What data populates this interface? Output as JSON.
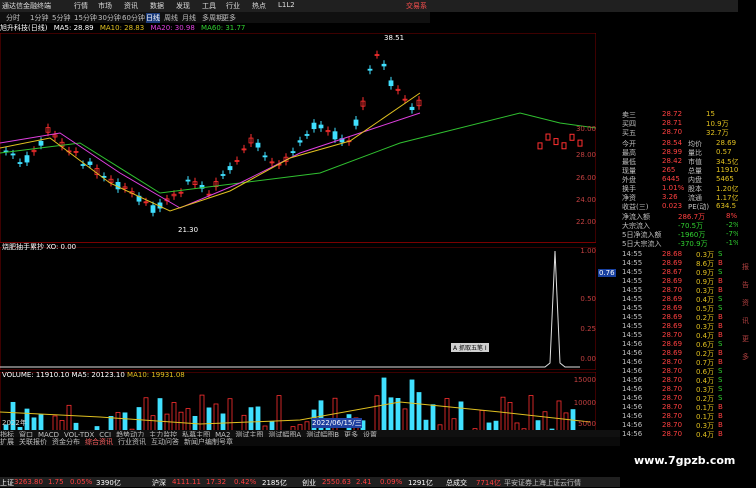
{
  "titlebar": {
    "app": "通达信金融终端",
    "menu": [
      "行情",
      "市场",
      "资讯",
      "数据",
      "发现",
      "工具",
      "行业",
      "热点",
      "L1L2"
    ],
    "right_label": "交易系"
  },
  "periods": [
    "分时",
    "1分钟",
    "5分钟",
    "15分钟",
    "30分钟",
    "60分钟",
    "日线",
    "周线",
    "月线",
    "多周期",
    "更多"
  ],
  "active_period": "日线",
  "stock": {
    "name": "旭升科技(日线)",
    "ma5": "MA5: 28.89",
    "ma10": "MA10: 28.83",
    "ma20": "MA20: 30.98",
    "ma60": "MA60: 31.77",
    "peak_label": "38.51",
    "low_label": "21.30"
  },
  "price_scale": [
    "30.00",
    "28.00",
    "26.00",
    "24.00",
    "22.00"
  ],
  "indicator": {
    "title": "烧肥抽手累抄 XO: 0.00",
    "scale": [
      "1.00",
      "0.76",
      "0.50",
      "0.25",
      "0.00"
    ],
    "tag": "0.76",
    "overlay_label": "A 抓取五笔 I"
  },
  "volume": {
    "title": "VOLUME: 11910.10",
    "ma5": "MA5: 20123.10",
    "ma10": "MA10: 19931.08",
    "scale": [
      "15000",
      "10000",
      "5000"
    ],
    "date_label": "2022/06/15/三",
    "year_label": "2022年"
  },
  "quote": {
    "ask": [
      {
        "label": "卖三",
        "price": "28.72",
        "vol": "15"
      },
      {
        "label": "买四",
        "price": "28.71",
        "vol": "10.9万"
      },
      {
        "label": "买五",
        "price": "28.70",
        "vol": "32.7万"
      }
    ],
    "stats": [
      {
        "l": "今开",
        "v": "28.54",
        "l2": "均价",
        "v2": "28.69"
      },
      {
        "l": "最高",
        "v": "28.99",
        "l2": "量比",
        "v2": "0.57"
      },
      {
        "l": "最低",
        "v": "28.42",
        "l2": "市值",
        "v2": "34.5亿"
      },
      {
        "l": "现量",
        "v": "265",
        "l2": "总量",
        "v2": "11910"
      },
      {
        "l": "外盘",
        "v": "6445",
        "l2": "内盘",
        "v2": "5465"
      },
      {
        "l": "换手",
        "v": "1.01%",
        "l2": "股本",
        "v2": "1.20亿"
      },
      {
        "l": "净资",
        "v": "3.26",
        "l2": "流通",
        "v2": "1.17亿"
      },
      {
        "l": "收益(三)",
        "v": "0.023",
        "l2": "PE(动)",
        "v2": "634.5"
      }
    ],
    "flows": [
      {
        "l": "净流入额",
        "v": "286.7万",
        "p": "8%"
      },
      {
        "l": "大宗流入",
        "v": "-70.5万",
        "p": "-2%"
      },
      {
        "l": "5日净流入额",
        "v": "-1960万",
        "p": "-7%"
      },
      {
        "l": "5日大宗流入",
        "v": "-370.9万",
        "p": "-1%"
      }
    ],
    "ticks": [
      {
        "t": "14:55",
        "p": "28.68",
        "v": "0.3万",
        "d": "S"
      },
      {
        "t": "14:55",
        "p": "28.69",
        "v": "8.6万",
        "d": "B"
      },
      {
        "t": "14:55",
        "p": "28.67",
        "v": "0.9万",
        "d": "S"
      },
      {
        "t": "14:55",
        "p": "28.69",
        "v": "0.9万",
        "d": "B"
      },
      {
        "t": "14:55",
        "p": "28.70",
        "v": "0.3万",
        "d": "B"
      },
      {
        "t": "14:55",
        "p": "28.69",
        "v": "0.4万",
        "d": "S"
      },
      {
        "t": "14:55",
        "p": "28.69",
        "v": "0.5万",
        "d": "S"
      },
      {
        "t": "14:55",
        "p": "28.69",
        "v": "0.2万",
        "d": "B"
      },
      {
        "t": "14:55",
        "p": "28.69",
        "v": "0.3万",
        "d": "B"
      },
      {
        "t": "14:55",
        "p": "28.70",
        "v": "0.4万",
        "d": "B"
      },
      {
        "t": "14:56",
        "p": "28.69",
        "v": "0.6万",
        "d": "S"
      },
      {
        "t": "14:56",
        "p": "28.69",
        "v": "0.2万",
        "d": "B"
      },
      {
        "t": "14:56",
        "p": "28.70",
        "v": "0.7万",
        "d": "B"
      },
      {
        "t": "14:56",
        "p": "28.70",
        "v": "0.6万",
        "d": "S"
      },
      {
        "t": "14:56",
        "p": "28.70",
        "v": "0.4万",
        "d": "S"
      },
      {
        "t": "14:56",
        "p": "28.70",
        "v": "0.3万",
        "d": "S"
      },
      {
        "t": "14:56",
        "p": "28.70",
        "v": "0.2万",
        "d": "S"
      },
      {
        "t": "14:56",
        "p": "28.70",
        "v": "0.1万",
        "d": "B"
      },
      {
        "t": "14:56",
        "p": "28.70",
        "v": "0.1万",
        "d": "B"
      },
      {
        "t": "14:56",
        "p": "28.70",
        "v": "0.3万",
        "d": "B"
      },
      {
        "t": "14:56",
        "p": "28.70",
        "v": "0.4万",
        "d": "B"
      }
    ]
  },
  "tabs": [
    "指标",
    "窗口",
    "MACD",
    "VOL-TDX",
    "CCI",
    "趋势动力",
    "主力监控",
    "私募主图",
    "MA2",
    "测试主图",
    "测试幅图A",
    "测试幅图B",
    "更多",
    "设置"
  ],
  "tabs2": [
    "扩展",
    "关联报价",
    "资金分布",
    "综合资讯",
    "行业资讯",
    "互动问答",
    "新闻户编制号章"
  ],
  "status": [
    {
      "l": "上证",
      "v": "3263.80",
      "c": "1.75",
      "p": "0.05%",
      "a": "3390亿"
    },
    {
      "l": "沪深",
      "v": "4111.11",
      "c": "17.32",
      "p": "0.42%",
      "a": "2185亿"
    },
    {
      "l": "创业",
      "v": "2550.63",
      "c": "2.41",
      "p": "0.09%",
      "a": "1291亿"
    },
    {
      "l": "总成交",
      "v": "7714亿",
      "c": "",
      "p": "",
      "a": ""
    }
  ],
  "status_right": "平安证券上海上证云行情",
  "watermark": "www.7gpzb.com",
  "edge_labels": [
    "报",
    "告",
    "资",
    "讯",
    "更",
    "多"
  ]
}
